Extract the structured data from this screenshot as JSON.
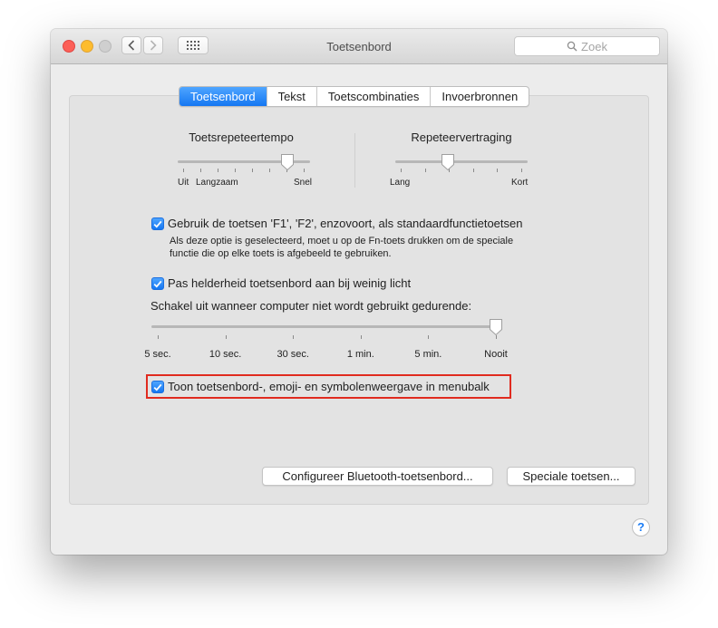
{
  "window": {
    "title": "Toetsenbord",
    "search": {
      "placeholder": "Zoek"
    }
  },
  "tabs": [
    {
      "label": "Toetsenbord",
      "active": true
    },
    {
      "label": "Tekst",
      "active": false
    },
    {
      "label": "Toetscombinaties",
      "active": false
    },
    {
      "label": "Invoerbronnen",
      "active": false
    }
  ],
  "key_repeat": {
    "label": "Toetsrepeteertempo",
    "min_labels": [
      "Uit",
      "Langzaam"
    ],
    "max_label": "Snel",
    "value": 0.83,
    "ticks": 8
  },
  "repeat_delay": {
    "label": "Repeteervertraging",
    "min_label": "Lang",
    "max_label": "Kort",
    "value": 0.4,
    "ticks": 6
  },
  "fn_keys": {
    "checked": true,
    "label": "Gebruik de toetsen 'F1', 'F2', enzovoort, als standaardfunctietoetsen",
    "note_line1": "Als deze optie is geselecteerd, moet u op de Fn-toets drukken om de speciale",
    "note_line2": "functie die op elke toets is afgebeeld te gebruiken."
  },
  "brightness": {
    "checked": true,
    "label": "Pas helderheid toetsenbord aan bij weinig licht"
  },
  "turn_off": {
    "label": "Schakel uit wanneer computer niet wordt gebruikt gedurende:",
    "ticks": [
      "5 sec.",
      "10 sec.",
      "30 sec.",
      "1 min.",
      "5 min.",
      "Nooit"
    ],
    "selected_index": 5
  },
  "menubar_viewer": {
    "checked": true,
    "label": "Toon toetsenbord-, emoji- en symbolenweergave in menubalk"
  },
  "buttons": {
    "bluetooth": "Configureer Bluetooth-toetsenbord...",
    "special_keys": "Speciale toetsen..."
  },
  "help": "?",
  "colors": {
    "accent": "#1577f2",
    "highlight_border": "#e02b1f"
  }
}
